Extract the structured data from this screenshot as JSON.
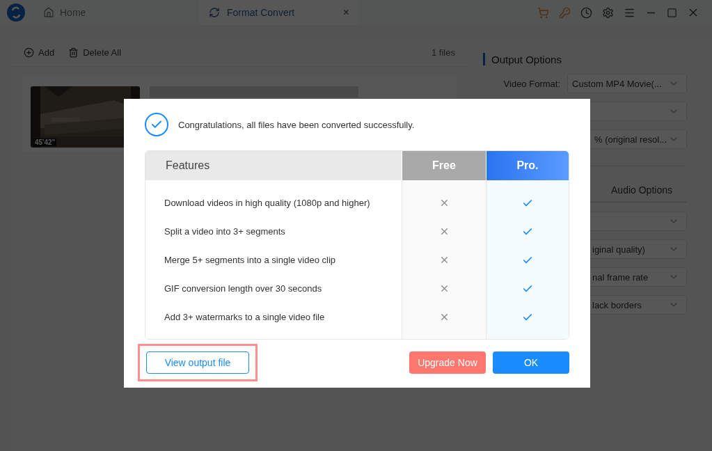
{
  "title_bar": {
    "home_tab": "Home",
    "active_tab": "Format Convert",
    "close_tab": "×"
  },
  "toolbar": {
    "add": "Add",
    "delete_all": "Delete All",
    "file_count": "1 files"
  },
  "file": {
    "duration": "45'42\""
  },
  "output_options": {
    "title": "Output Options",
    "video_format_label": "Video Format:",
    "upper_fields": [
      {
        "kind": "text",
        "value": "Custom MP4 Movie(..."
      },
      {
        "kind": "empty"
      },
      {
        "kind": "cut",
        "value": "% (original resol..."
      }
    ],
    "audio_tab": "Audio Options",
    "lower_fields": [
      {
        "kind": "empty"
      },
      {
        "kind": "cut",
        "value": "iginal quality)"
      },
      {
        "kind": "cut",
        "value": "nal frame rate"
      },
      {
        "kind": "cut",
        "value": "lack borders"
      }
    ]
  },
  "dialog": {
    "message": "Congratulations, all files have been converted successfully.",
    "columns": [
      "Features",
      "Free",
      "Pro."
    ],
    "rows": [
      {
        "feature": "Download videos in high quality (1080p and higher)",
        "free": false,
        "pro": true
      },
      {
        "feature": "Split a video into 3+ segments",
        "free": false,
        "pro": true
      },
      {
        "feature": "Merge 5+ segments into a single video clip",
        "free": false,
        "pro": true
      },
      {
        "feature": "GIF conversion length over 30 seconds",
        "free": false,
        "pro": true
      },
      {
        "feature": "Add 3+ watermarks to a single video file",
        "free": false,
        "pro": true
      }
    ],
    "buttons": [
      {
        "label": "View output file",
        "kind": "outline",
        "highlighted": true
      },
      {
        "label": "Upgrade Now",
        "kind": "upgrade",
        "highlighted": false
      },
      {
        "label": "OK",
        "kind": "primary",
        "highlighted": false
      }
    ]
  }
}
